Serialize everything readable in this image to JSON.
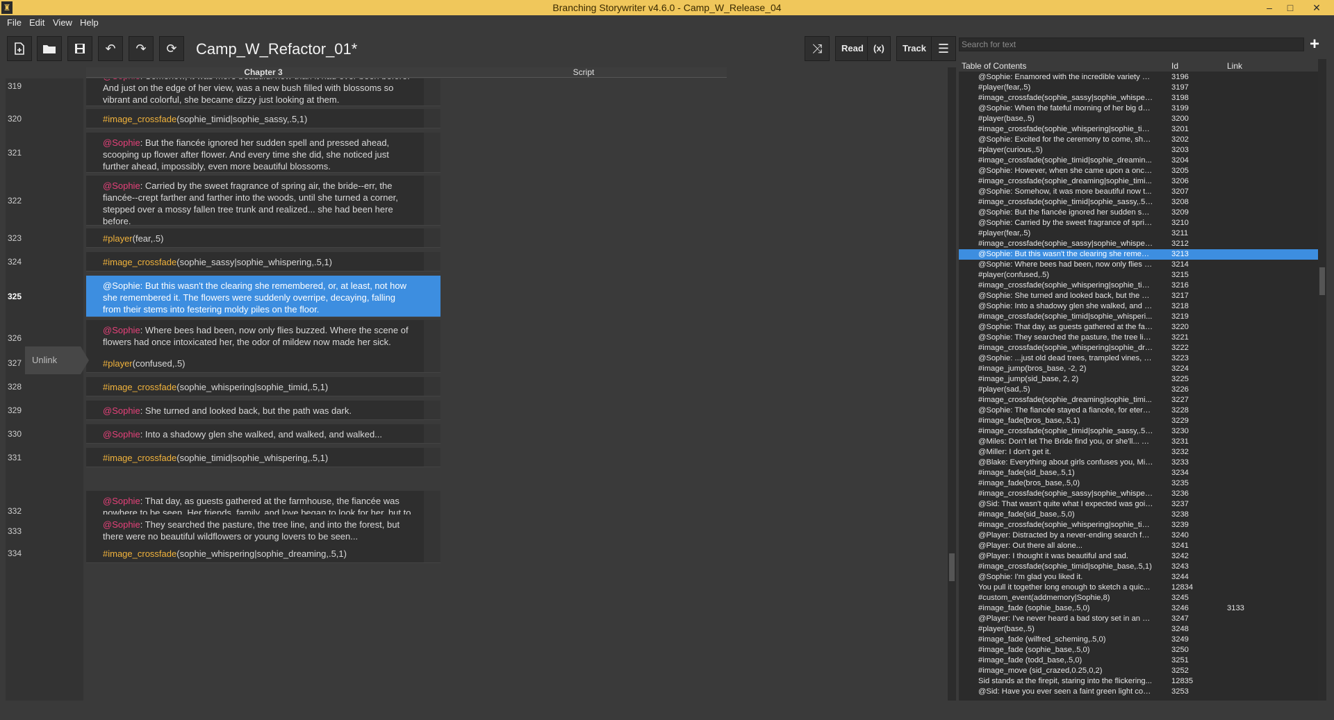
{
  "window": {
    "title": "Branching Storywriter v4.6.0 - Camp_W_Release_04",
    "app_icon": "storywriter-logo-icon",
    "controls": {
      "minimize": "–",
      "maximize": "□",
      "close": "✕"
    }
  },
  "menu": [
    "File",
    "Edit",
    "View",
    "Help"
  ],
  "toolbar": {
    "doc_title": "Camp_W_Refactor_01*",
    "read": "Read",
    "vars": "(x)",
    "track": "Track",
    "search_placeholder": "Search for text",
    "add": "+"
  },
  "editor": {
    "chapter_header": "Chapter 3",
    "script_header": "Script",
    "unlink": "Unlink",
    "rows": [
      {
        "num": "319",
        "parts": [
          {
            "k": "speaker",
            "t": "@Sophie"
          },
          {
            "k": "text",
            "t": ": Somehow, it was more beautiful now than it had ever been before. And just on the edge of her view, was a new bush filled with blossoms so vibrant and colorful, she became dizzy just looking at them."
          }
        ]
      },
      {
        "num": "320",
        "parts": [
          {
            "k": "cmd",
            "t": "#image_crossfade"
          },
          {
            "k": "text",
            "t": "(sophie_timid|sophie_sassy,.5,1)"
          }
        ]
      },
      {
        "num": "321",
        "parts": [
          {
            "k": "speaker",
            "t": "@Sophie"
          },
          {
            "k": "text",
            "t": ": But the fiancée ignored her sudden spell and pressed ahead, scooping up flower after flower. And every time she did, she noticed just further ahead, impossibly, even more beautiful blossoms."
          }
        ]
      },
      {
        "num": "322",
        "parts": [
          {
            "k": "speaker",
            "t": "@Sophie"
          },
          {
            "k": "text",
            "t": ": Carried by the sweet fragrance of spring air, the bride--err, the fiancée--crept farther and farther into the woods, until she turned a corner, stepped over a mossy fallen tree trunk and realized... she had been here before."
          }
        ]
      },
      {
        "num": "323",
        "parts": [
          {
            "k": "cmd",
            "t": "#player"
          },
          {
            "k": "text",
            "t": "(fear,.5)"
          }
        ]
      },
      {
        "num": "324",
        "parts": [
          {
            "k": "cmd",
            "t": "#image_crossfade"
          },
          {
            "k": "text",
            "t": "(sophie_sassy|sophie_whispering,.5,1)"
          }
        ]
      },
      {
        "num": "325",
        "parts": [
          {
            "k": "text",
            "t": "@Sophie: But this wasn't the clearing she remembered, or, at least, not how she remembered it. The flowers were suddenly overripe, decaying, falling from their stems into festering moldy piles on the floor."
          }
        ]
      },
      {
        "num": "326",
        "parts": [
          {
            "k": "speaker",
            "t": "@Sophie"
          },
          {
            "k": "text",
            "t": ": Where bees had been, now only flies buzzed. Where the scene of flowers had once intoxicated her, the odor of mildew now made her sick."
          }
        ]
      },
      {
        "num": "327",
        "parts": [
          {
            "k": "cmd",
            "t": "#player"
          },
          {
            "k": "text",
            "t": "(confused,.5)"
          }
        ]
      },
      {
        "num": "328",
        "parts": [
          {
            "k": "cmd",
            "t": "#image_crossfade"
          },
          {
            "k": "text",
            "t": "(sophie_whispering|sophie_timid,.5,1)"
          }
        ]
      },
      {
        "num": "329",
        "parts": [
          {
            "k": "speaker",
            "t": "@Sophie"
          },
          {
            "k": "text",
            "t": ": She turned and looked back, but the path was dark."
          }
        ]
      },
      {
        "num": "330",
        "parts": [
          {
            "k": "speaker",
            "t": "@Sophie"
          },
          {
            "k": "text",
            "t": ": Into a shadowy glen she walked, and walked, and walked..."
          }
        ]
      },
      {
        "num": "331",
        "parts": [
          {
            "k": "cmd",
            "t": "#image_crossfade"
          },
          {
            "k": "text",
            "t": "(sophie_timid|sophie_whispering,.5,1)"
          }
        ]
      },
      {
        "num": "332",
        "parts": [
          {
            "k": "speaker",
            "t": "@Sophie"
          },
          {
            "k": "text",
            "t": ": That day, as guests gathered at the farmhouse, the fiancée was nowhere to be seen. Her friends, family, and love began to look for her, but to no avail."
          }
        ]
      },
      {
        "num": "333",
        "parts": [
          {
            "k": "speaker",
            "t": "@Sophie"
          },
          {
            "k": "text",
            "t": ": They searched the pasture, the tree line, and into the forest, but there were no beautiful wildflowers or young lovers to be seen..."
          }
        ]
      },
      {
        "num": "334",
        "parts": [
          {
            "k": "cmd",
            "t": "#image_crossfade"
          },
          {
            "k": "text",
            "t": "(sophie_whispering|sophie_dreaming,.5,1)"
          }
        ]
      }
    ]
  },
  "toc": {
    "headers": {
      "title": "Table of Contents",
      "id": "Id",
      "link": "Link"
    },
    "rows": [
      {
        "t": "@Sophie: Enamored with the incredible variety of...",
        "id": "3196",
        "link": ""
      },
      {
        "t": "#player(fear,.5)",
        "id": "3197",
        "link": ""
      },
      {
        "t": "#image_crossfade(sophie_sassy|sophie_whisperin...",
        "id": "3198",
        "link": ""
      },
      {
        "t": "@Sophie: When the fateful morning of her big da...",
        "id": "3199",
        "link": ""
      },
      {
        "t": "#player(base,.5)",
        "id": "3200",
        "link": ""
      },
      {
        "t": "#image_crossfade(sophie_whispering|sophie_tim...",
        "id": "3201",
        "link": ""
      },
      {
        "t": "@Sophie: Excited for the ceremony to come, she ...",
        "id": "3202",
        "link": ""
      },
      {
        "t": "#player(curious,.5)",
        "id": "3203",
        "link": ""
      },
      {
        "t": "#image_crossfade(sophie_timid|sophie_dreamin...",
        "id": "3204",
        "link": ""
      },
      {
        "t": "@Sophie: However, when she came upon a once ...",
        "id": "3205",
        "link": ""
      },
      {
        "t": "#image_crossfade(sophie_dreaming|sophie_timi...",
        "id": "3206",
        "link": ""
      },
      {
        "t": "@Sophie: Somehow, it was more beautiful now t...",
        "id": "3207",
        "link": ""
      },
      {
        "t": "#image_crossfade(sophie_timid|sophie_sassy,.5,1)",
        "id": "3208",
        "link": ""
      },
      {
        "t": "@Sophie: But the fiancée ignored her sudden spe...",
        "id": "3209",
        "link": ""
      },
      {
        "t": "@Sophie: Carried by the sweet fragrance of sprin...",
        "id": "3210",
        "link": ""
      },
      {
        "t": "#player(fear,.5)",
        "id": "3211",
        "link": ""
      },
      {
        "t": "#image_crossfade(sophie_sassy|sophie_whisperin...",
        "id": "3212",
        "link": ""
      },
      {
        "t": "@Sophie: But this wasn't the clearing she remem...",
        "id": "3213",
        "link": "",
        "sel": true
      },
      {
        "t": "@Sophie: Where bees had been, now only flies b...",
        "id": "3214",
        "link": ""
      },
      {
        "t": "#player(confused,.5)",
        "id": "3215",
        "link": ""
      },
      {
        "t": "#image_crossfade(sophie_whispering|sophie_tim...",
        "id": "3216",
        "link": ""
      },
      {
        "t": "@Sophie: She turned and looked back, but the pa...",
        "id": "3217",
        "link": ""
      },
      {
        "t": "@Sophie: Into a shadowy glen she walked, and w...",
        "id": "3218",
        "link": ""
      },
      {
        "t": "#image_crossfade(sophie_timid|sophie_whisperi...",
        "id": "3219",
        "link": ""
      },
      {
        "t": "@Sophie: That day, as guests gathered at the far...",
        "id": "3220",
        "link": ""
      },
      {
        "t": "@Sophie: They searched the pasture, the tree line...",
        "id": "3221",
        "link": ""
      },
      {
        "t": "#image_crossfade(sophie_whispering|sophie_dre...",
        "id": "3222",
        "link": ""
      },
      {
        "t": "@Sophie: ...just old dead trees, trampled vines, a...",
        "id": "3223",
        "link": ""
      },
      {
        "t": "#image_jump(bros_base, -2, 2)",
        "id": "3224",
        "link": ""
      },
      {
        "t": "#image_jump(sid_base, 2, 2)",
        "id": "3225",
        "link": ""
      },
      {
        "t": "#player(sad,.5)",
        "id": "3226",
        "link": ""
      },
      {
        "t": "#image_crossfade(sophie_dreaming|sophie_timi...",
        "id": "3227",
        "link": ""
      },
      {
        "t": "@Sophie: The fiancée stayed a fiancée, for eternit...",
        "id": "3228",
        "link": ""
      },
      {
        "t": "#image_fade(bros_base,.5,1)",
        "id": "3229",
        "link": ""
      },
      {
        "t": "#image_crossfade(sophie_timid|sophie_sassy,.5,1)",
        "id": "3230",
        "link": ""
      },
      {
        "t": "@Miles: Don't let The Bride find you, or she'll... br...",
        "id": "3231",
        "link": ""
      },
      {
        "t": "@Miller: I don't get it.",
        "id": "3232",
        "link": ""
      },
      {
        "t": "@Blake: Everything about girls confuses you, Mill...",
        "id": "3233",
        "link": ""
      },
      {
        "t": "#image_fade(sid_base,.5,1)",
        "id": "3234",
        "link": ""
      },
      {
        "t": "#image_fade(bros_base,.5,0)",
        "id": "3235",
        "link": ""
      },
      {
        "t": "#image_crossfade(sophie_sassy|sophie_whisperin...",
        "id": "3236",
        "link": ""
      },
      {
        "t": "@Sid: That wasn't quite what I expected was goin...",
        "id": "3237",
        "link": ""
      },
      {
        "t": "#image_fade(sid_base,.5,0)",
        "id": "3238",
        "link": ""
      },
      {
        "t": "#image_crossfade(sophie_whispering|sophie_tim...",
        "id": "3239",
        "link": ""
      },
      {
        "t": "@Player: Distracted by a never-ending search for ...",
        "id": "3240",
        "link": ""
      },
      {
        "t": "@Player: Out there all alone...",
        "id": "3241",
        "link": ""
      },
      {
        "t": "@Player: I thought it was beautiful and sad.",
        "id": "3242",
        "link": ""
      },
      {
        "t": "#image_crossfade(sophie_timid|sophie_base,.5,1)",
        "id": "3243",
        "link": ""
      },
      {
        "t": "@Sophie: I'm glad you liked it.",
        "id": "3244",
        "link": ""
      },
      {
        "t": "You pull it together long enough to sketch a quic...",
        "id": "12834",
        "link": ""
      },
      {
        "t": "#custom_event(addmemory|Sophie,8)",
        "id": "3245",
        "link": ""
      },
      {
        "t": "#image_fade (sophie_base,.5,0)",
        "id": "3246",
        "link": "3133"
      },
      {
        "t": "@Player: I've never heard a bad story set in an ab...",
        "id": "3247",
        "link": ""
      },
      {
        "t": "#player(base,.5)",
        "id": "3248",
        "link": ""
      },
      {
        "t": "#image_fade (wilfred_scheming,.5,0)",
        "id": "3249",
        "link": ""
      },
      {
        "t": "#image_fade (sophie_base,.5,0)",
        "id": "3250",
        "link": ""
      },
      {
        "t": "#image_fade (todd_base,.5,0)",
        "id": "3251",
        "link": ""
      },
      {
        "t": "#image_move (sid_crazed,0.25,0,2)",
        "id": "3252",
        "link": ""
      },
      {
        "t": "Sid stands at the firepit, staring into the flickering...",
        "id": "12835",
        "link": ""
      },
      {
        "t": "@Sid: Have you ever seen a faint green light com...",
        "id": "3253",
        "link": ""
      }
    ]
  },
  "colors": {
    "titlebar": "#f0c75b",
    "selection": "#3d8ee0",
    "speaker": "#e6417a",
    "command": "#f1b33c"
  }
}
